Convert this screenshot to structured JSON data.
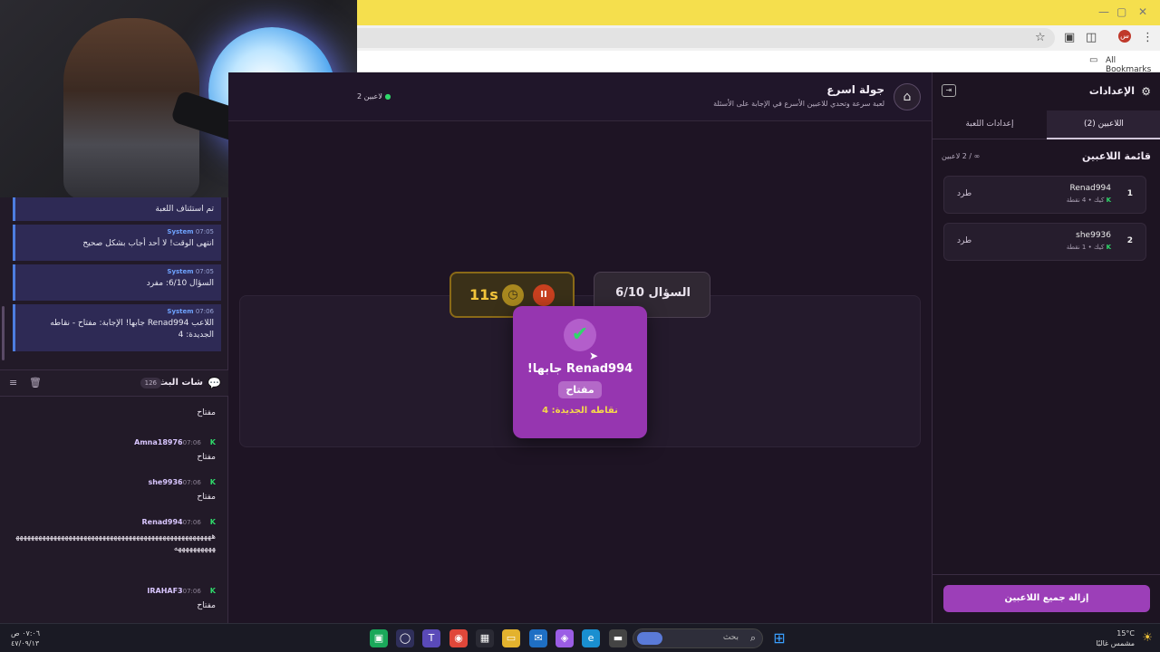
{
  "browser": {
    "bookmarks_label": "All Bookmarks",
    "profile_initial": "س"
  },
  "left_panel": {
    "system_messages": [
      {
        "who": "",
        "time": "",
        "text": "تم استئناف اللعبة"
      },
      {
        "who": "System",
        "time": "07:05",
        "text": "انتهى الوقت! لا أحد أجاب بشكل صحيح"
      },
      {
        "who": "System",
        "time": "07:05",
        "text": "السؤال 6/10: مفرد"
      },
      {
        "who": "System",
        "time": "07:06",
        "text": "اللاعب Renad994 جابها! الإجابة: مفتاح - نقاطه الجديدة: 4"
      }
    ],
    "chat_title": "شات البث",
    "chat_count": "126",
    "chat_messages": [
      {
        "name": "",
        "time": "",
        "text": "مفتاح"
      },
      {
        "name": "Amna18976",
        "time": "07:06",
        "text": "مفتاح"
      },
      {
        "name": "she9936",
        "time": "07:06",
        "text": "مفتاح"
      },
      {
        "name": "Renad994",
        "time": "07:06",
        "text": "هههههههههههههههههههههههههههههههههههههههههههههههههههههههههههههههه"
      },
      {
        "name": "IRAHAF3",
        "time": "07:06",
        "text": "مفتاح"
      }
    ]
  },
  "game": {
    "title": "جولة اسرع",
    "subtitle": "لعبة سرعة وتحدي للاعبين الأسرع في الإجابة على الأسئلة",
    "players_online": "2 لاعبين",
    "timer_value": "11s",
    "question_label": "السؤال 6/10",
    "popup": {
      "headline": "Renad994 جابها!",
      "answer": "مفتاح",
      "points_text": "نقاطه الجديدة: 4"
    }
  },
  "settings": {
    "title": "الإعدادات",
    "tabs": [
      {
        "label": "اللاعبين (2)",
        "active": true
      },
      {
        "label": "إعدادات اللعبة",
        "active": false
      }
    ],
    "players_list_title": "قائمة اللاعبين",
    "players_count": "∞ / 2 لاعبين",
    "players": [
      {
        "rank": "1",
        "name": "Renad994",
        "platform": "كيك",
        "points": "4 نقطة",
        "kick_label": "طرد"
      },
      {
        "rank": "2",
        "name": "she9936",
        "platform": "كيك",
        "points": "1 نقطة",
        "kick_label": "طرد"
      }
    ],
    "remove_all_label": "إزالة جميع اللاعبين"
  },
  "taskbar": {
    "time": "٠٧:٠٦ ص",
    "date": "٤٧/٠٩/١٣",
    "search_placeholder": "بحث",
    "weather_temp": "15°C",
    "weather_desc": "مشمس غالبًا"
  },
  "colors": {
    "accent_purple": "#9636b0",
    "kick_green": "#2fd86a",
    "timer_gold": "#e0b22a",
    "system_blue": "#4d7de0"
  }
}
